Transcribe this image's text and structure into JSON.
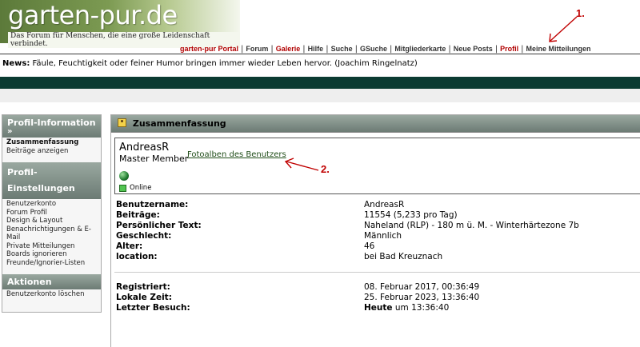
{
  "header": {
    "logo_title": "garten-pur.de",
    "logo_subtitle": "Das Forum für Menschen, die eine große Leidenschaft verbindet."
  },
  "navbar": {
    "items": [
      {
        "label": "garten-pur Portal",
        "color": "#b10000"
      },
      {
        "label": "Forum",
        "color": "#333333"
      },
      {
        "label": "Galerie",
        "color": "#b10000"
      },
      {
        "label": "Hilfe",
        "color": "#333333"
      },
      {
        "label": "Suche",
        "color": "#333333"
      },
      {
        "label": "GSuche",
        "color": "#333333"
      },
      {
        "label": "Mitgliederkarte",
        "color": "#333333"
      },
      {
        "label": "Neue Posts",
        "color": "#333333"
      },
      {
        "label": "Profil",
        "color": "#b10000"
      },
      {
        "label": "Meine Mitteilungen",
        "color": "#333333"
      }
    ]
  },
  "news": {
    "label": "News:",
    "text": "Fäule, Feuchtigkeit oder feiner Humor bringen immer wieder Leben hervor. (Joachim Ringelnatz)"
  },
  "sidebar": {
    "profile_info_heading": "Profil-Information",
    "profile_info_arrow": "»",
    "profile_info_items": [
      {
        "label": "Zusammenfassung",
        "active": true
      },
      {
        "label": "Beiträge anzeigen",
        "active": false
      }
    ],
    "settings_heading": "Profil-Einstellungen",
    "settings_items": [
      "Benutzerkonto",
      "Forum Profil",
      "Design & Layout",
      "Benachrichtigungen & E-Mail",
      "Private Mitteilungen",
      "Boards ignorieren",
      "Freunde/Ignorier-Listen"
    ],
    "actions_heading": "Aktionen",
    "actions_items": [
      "Benutzerkonto löschen"
    ]
  },
  "main": {
    "title": "Zusammenfassung",
    "username": "AndreasR",
    "rank": "Master Member",
    "album_link": "Fotoalben des Benutzers",
    "status": "Online",
    "details": [
      {
        "label": "Benutzername:",
        "value": "AndreasR"
      },
      {
        "label": "Beiträge:",
        "value": "11554 (5,233 pro Tag)"
      },
      {
        "label": "Persönlicher Text:",
        "value": "Naheland (RLP) - 180 m ü. M. - Winterhärtezone 7b"
      },
      {
        "label": "Geschlecht:",
        "value": "Männlich"
      },
      {
        "label": "Alter:",
        "value": "46"
      },
      {
        "label": "location:",
        "value": "bei Bad Kreuznach"
      }
    ],
    "dates": [
      {
        "label": "Registriert:",
        "value": "08. Februar 2017, 00:36:49"
      },
      {
        "label": "Lokale Zeit:",
        "value": "25. Februar 2023, 13:36:40"
      },
      {
        "label": "Letzter Besuch:",
        "value_bold": "Heute",
        "value": " um 13:36:40"
      }
    ]
  },
  "annotations": {
    "one": "1.",
    "two": "2."
  },
  "colors": {
    "dark_bar": "#0b3b32",
    "accent_red": "#b10000",
    "annotation_red": "#c00000"
  }
}
